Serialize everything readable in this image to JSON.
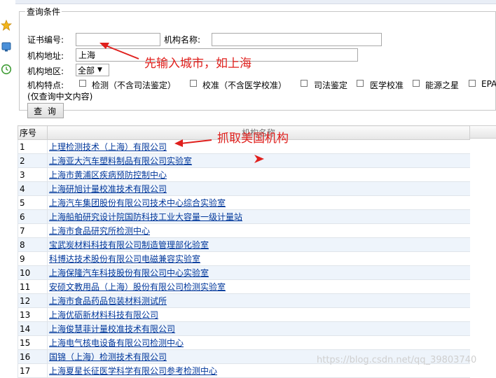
{
  "query": {
    "legend": "查询条件",
    "cert_label": "证书编号:",
    "cert_value": "",
    "org_name_label": "机构名称:",
    "org_name_value": "",
    "address_label": "机构地址:",
    "address_value": "上海",
    "region_label": "机构地区:",
    "region_value": "全部",
    "features_label": "机构特点:",
    "features": [
      "检测（不含司法鉴定）",
      "校准（不含医学校准）",
      "司法鉴定",
      "医学校准",
      "能源之星",
      "EPA"
    ],
    "hint": "(仅查询中文内容)",
    "search_button": "查 询"
  },
  "annotations": {
    "address_note": "先输入城市，如上海",
    "table_note": "抓取美国机构"
  },
  "table": {
    "col_index": "序号",
    "col_name": "机构名称",
    "rows": [
      {
        "idx": "1",
        "name": "上理检测技术（上海）有限公司"
      },
      {
        "idx": "2",
        "name": "上海亚大汽车塑料制品有限公司实验室"
      },
      {
        "idx": "3",
        "name": "上海市黄浦区疾病预防控制中心"
      },
      {
        "idx": "4",
        "name": "上海研旭计量校准技术有限公司"
      },
      {
        "idx": "5",
        "name": "上海汽车集团股份有限公司技术中心综合实验室"
      },
      {
        "idx": "6",
        "name": "上海船舶研究设计院国防科技工业大容量一级计量站"
      },
      {
        "idx": "7",
        "name": "上海市食品研究所检测中心"
      },
      {
        "idx": "8",
        "name": "宝武炭材料科技有限公司制造管理部化验室"
      },
      {
        "idx": "9",
        "name": "科博达技术股份有限公司电磁兼容实验室"
      },
      {
        "idx": "10",
        "name": "上海保隆汽车科技股份有限公司中心实验室"
      },
      {
        "idx": "11",
        "name": "安硕文教用品（上海）股份有限公司检测实验室"
      },
      {
        "idx": "12",
        "name": "上海市食品药品包装材料测试所"
      },
      {
        "idx": "13",
        "name": "上海优砺新材料科技有限公司"
      },
      {
        "idx": "14",
        "name": "上海俊慧菲计量校准技术有限公司"
      },
      {
        "idx": "15",
        "name": "上海电气核电设备有限公司检测中心"
      },
      {
        "idx": "16",
        "name": "国锦（上海）检测技术有限公司"
      },
      {
        "idx": "17",
        "name": "上海夏星长征医学科学有限公司参考检测中心"
      }
    ]
  },
  "watermark": "https://blog.csdn.net/qq_39803740",
  "colors": {
    "link": "#00379b",
    "annotation": "#e0201d",
    "row_alt": "#eef4fb"
  },
  "icons": [
    "star-icon",
    "monitor-icon",
    "clock-icon",
    "chevron-down-icon",
    "red-arrow-icon"
  ]
}
